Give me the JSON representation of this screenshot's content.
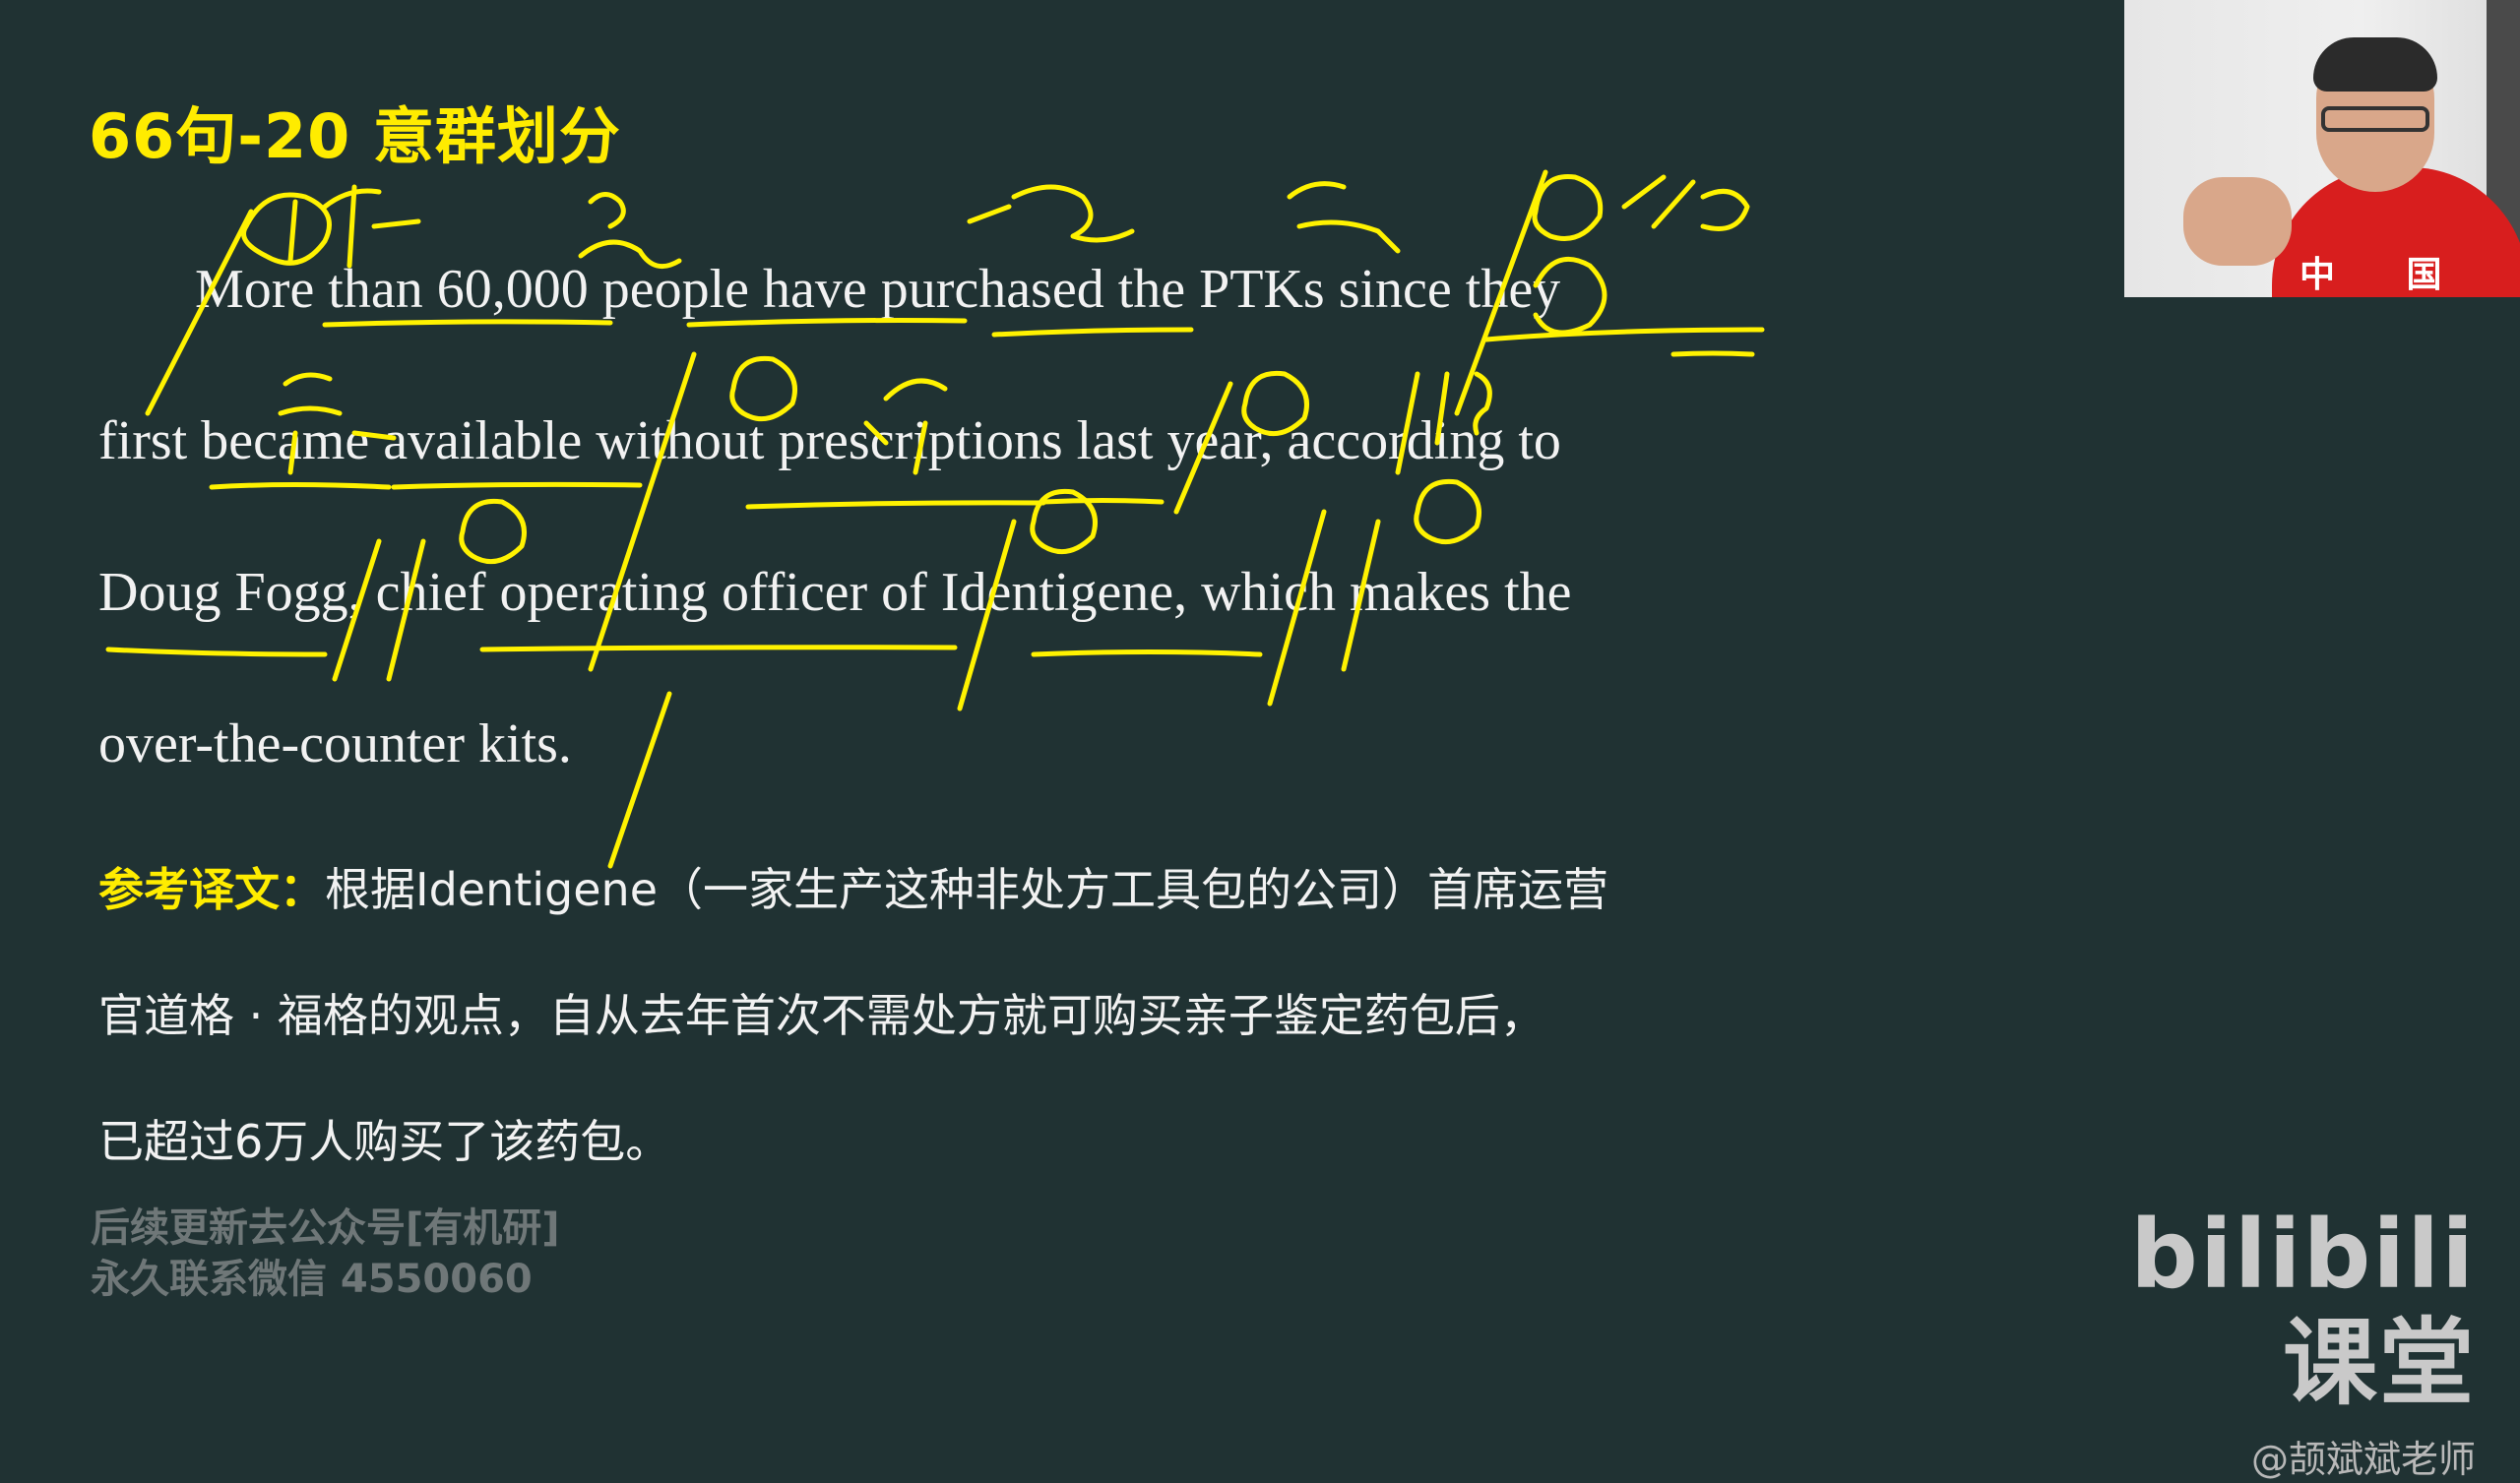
{
  "slide": {
    "title": "66句-20 意群划分",
    "english_lines": [
      "More than 60,000 people have purchased the PTKs since they",
      "first became available without prescriptions last year, according to",
      "Doug Fogg, chief operating officer of Identigene, which makes the",
      "over-the-counter kits."
    ],
    "translation_label": "参考译文：",
    "translation_lines": [
      "根据Identigene（一家生产这种非处方工具包的公司）首席运营",
      "官道格 · 福格的观点，自从去年首次不需处方就可购买亲子鉴定药包后，",
      "已超过6万人购买了该药包。"
    ],
    "watermark_lines": [
      "后续更新去公众号[有机研]",
      "永久联系微信 4550060"
    ]
  },
  "webcam": {
    "shirt_text": "中 国"
  },
  "brand": {
    "logo": "bilibili课堂",
    "user": "@颉斌斌老师"
  },
  "colors": {
    "background": "#203233",
    "accent_yellow": "#ffec00",
    "text": "#f2f2f2",
    "watermark": "#6f7778"
  }
}
